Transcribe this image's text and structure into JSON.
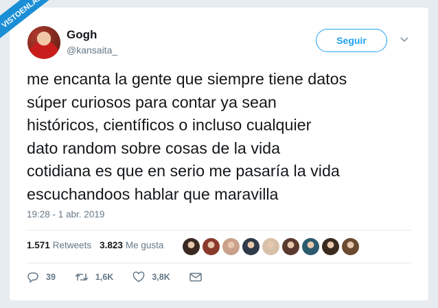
{
  "watermark": "VISTOENLASREDES.COM",
  "user": {
    "name": "Gogh",
    "handle": "@kansaita_"
  },
  "follow_label": "Seguir",
  "tweet_lines": [
    "me encanta la gente que siempre tiene datos",
    "súper curiosos para contar ya sean",
    "históricos, científicos o incluso cualquier",
    "dato random sobre cosas de la vida",
    "cotidiana es que en serio me pasaría la vida",
    "escuchandoos hablar que maravilla"
  ],
  "timestamp": "19:28 - 1 abr. 2019",
  "stats": {
    "retweets_count": "1.571",
    "retweets_label": "Retweets",
    "likes_count": "3.823",
    "likes_label": "Me gusta"
  },
  "liker_avatars": [
    "#3a2a22",
    "#8a3a2a",
    "#c9a08a",
    "#2f3a4a",
    "#d8c0a8",
    "#5a3a2e",
    "#2c5b6e",
    "#3b2a1e",
    "#6a4a30"
  ],
  "actions": {
    "replies": "39",
    "retweets": "1,6K",
    "likes": "3,8K"
  },
  "colors": {
    "accent": "#1da1f2",
    "text": "#14171a",
    "muted": "#657786",
    "badge": "#1b8fd6"
  }
}
